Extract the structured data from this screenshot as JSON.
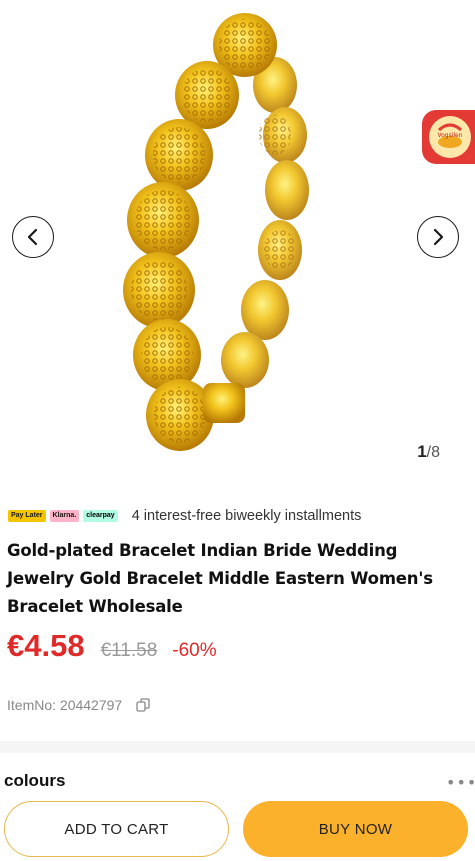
{
  "gallery": {
    "current": "1",
    "total": "/8",
    "prev_icon": "chevron-left-icon",
    "next_icon": "chevron-right-icon",
    "badge_icon": "vogsilen-promo-icon",
    "badge_text": "Vogsilen"
  },
  "payment": {
    "logos": [
      "Pay Later",
      "Klarna.",
      "clearpay"
    ],
    "text": "4 interest-free biweekly installments"
  },
  "product": {
    "title": "Gold-plated Bracelet Indian Bride Wedding Jewelry Gold Bracelet Middle Eastern Women's Bracelet Wholesale",
    "price": "€4.58",
    "original_price": "€11.58",
    "discount": "-60%",
    "item_no": "ItemNo: 20442797",
    "copy_icon": "copy-icon"
  },
  "options": {
    "colours_label": "colours",
    "more_icon": "more-dots-icon"
  },
  "actions": {
    "add_to_cart": "ADD TO CART",
    "buy_now": "BUY NOW"
  },
  "colors": {
    "price_red": "#e02a2a",
    "buy_yellow": "#fbb12c",
    "gold": "#e9b413"
  }
}
